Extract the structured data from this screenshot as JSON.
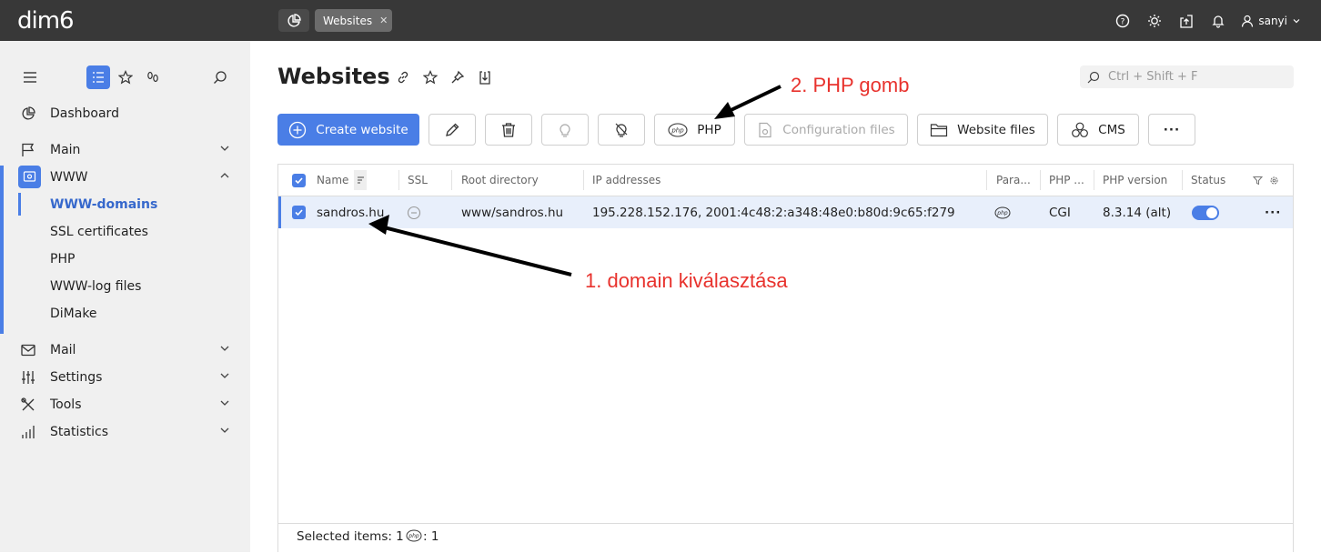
{
  "topbar": {
    "logo": "dim6",
    "tab_label": "Websites",
    "user_name": "sanyi",
    "icons": [
      "help-icon",
      "theme-sun-icon",
      "upload-icon",
      "notification-bell-icon",
      "user-icon"
    ]
  },
  "sidebar": {
    "nav": [
      {
        "label": "Dashboard"
      },
      {
        "label": "Main"
      },
      {
        "label": "WWW"
      },
      {
        "label": "Mail"
      },
      {
        "label": "Settings"
      },
      {
        "label": "Tools"
      },
      {
        "label": "Statistics"
      }
    ],
    "www_sub": [
      "WWW-domains",
      "SSL certificates",
      "PHP",
      "WWW-log files",
      "DiMake"
    ]
  },
  "page": {
    "title": "Websites",
    "search_placeholder": "Ctrl + Shift + F"
  },
  "toolbar": {
    "create": "Create website",
    "php": "PHP",
    "config": "Configuration files",
    "files": "Website files",
    "cms": "CMS",
    "more": "···"
  },
  "table": {
    "headers": {
      "name": "Name",
      "ssl": "SSL",
      "root": "Root directory",
      "ip": "IP addresses",
      "params": "Para...",
      "php_mode": "PHP ...",
      "php_version": "PHP version",
      "status": "Status"
    },
    "rows": [
      {
        "name": "sandros.hu",
        "root": "www/sandros.hu",
        "ip": "195.228.152.176, 2001:4c48:2:a348:48e0:b80d:9c65:f279",
        "php_mode": "CGI",
        "php_version": "8.3.14 (alt)",
        "status_on": true
      }
    ],
    "footer": {
      "selected": "Selected items: 1",
      "php_count": ": 1"
    }
  },
  "annotations": {
    "step1": "1. domain kiválasztása",
    "step2": "2. PHP gomb"
  },
  "colors": {
    "accent": "#4a7ee6",
    "topbar": "#383838",
    "annotation": "#e8322d"
  }
}
